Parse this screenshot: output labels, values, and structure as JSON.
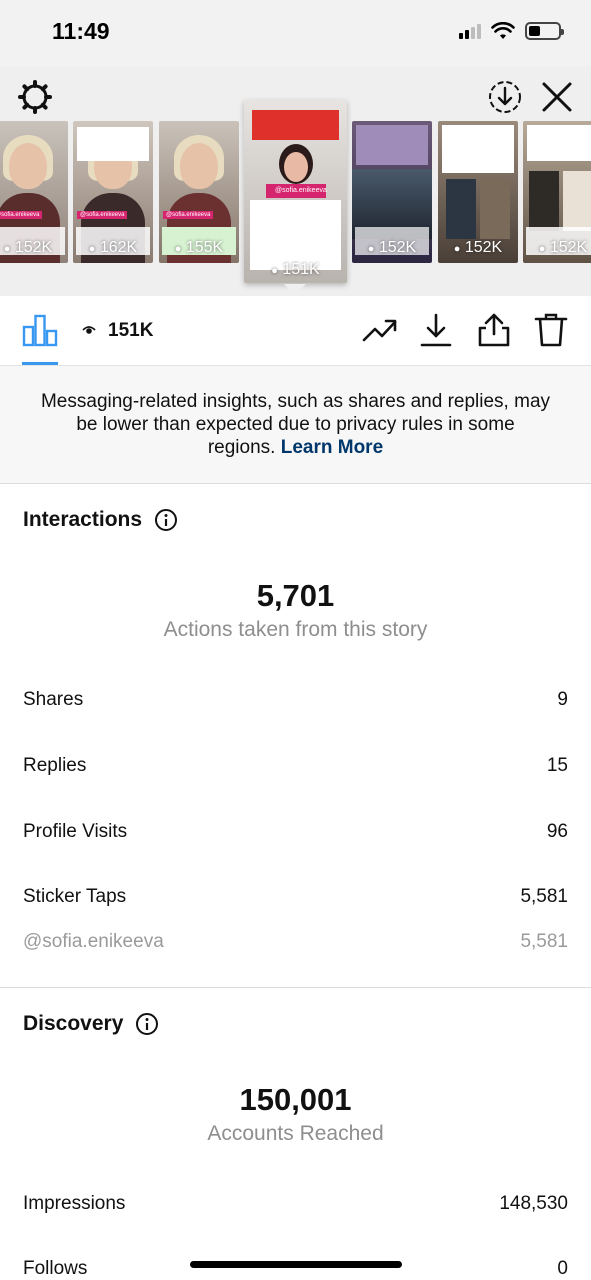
{
  "status_bar": {
    "time": "11:49"
  },
  "stories": [
    {
      "count": "152K",
      "tag": "@sofia.enikeeva"
    },
    {
      "count": "162K",
      "tag": "@sofia.enikeeva"
    },
    {
      "count": "155K",
      "tag": "@sofia.enikeeva"
    },
    {
      "count": "151K",
      "tag": "@sofia.enikeeva",
      "selected": true
    },
    {
      "count": "152K",
      "tag": ""
    },
    {
      "count": "152K",
      "tag": ""
    },
    {
      "count": "152K",
      "tag": ""
    }
  ],
  "toolbar": {
    "views": "151K"
  },
  "notice": {
    "text": "Messaging-related insights, such as shares and replies, may be lower than expected due to privacy rules in some regions.",
    "link": "Learn More"
  },
  "interactions": {
    "title": "Interactions",
    "total": "5,701",
    "subtitle": "Actions taken from this story",
    "rows": [
      {
        "label": "Shares",
        "value": "9"
      },
      {
        "label": "Replies",
        "value": "15"
      },
      {
        "label": "Profile Visits",
        "value": "96"
      },
      {
        "label": "Sticker Taps",
        "value": "5,581"
      }
    ],
    "sticker": {
      "label": "@sofia.enikeeva",
      "value": "5,581"
    }
  },
  "discovery": {
    "title": "Discovery",
    "total": "150,001",
    "subtitle": "Accounts Reached",
    "rows": [
      {
        "label": "Impressions",
        "value": "148,530"
      },
      {
        "label": "Follows",
        "value": "0"
      }
    ]
  }
}
